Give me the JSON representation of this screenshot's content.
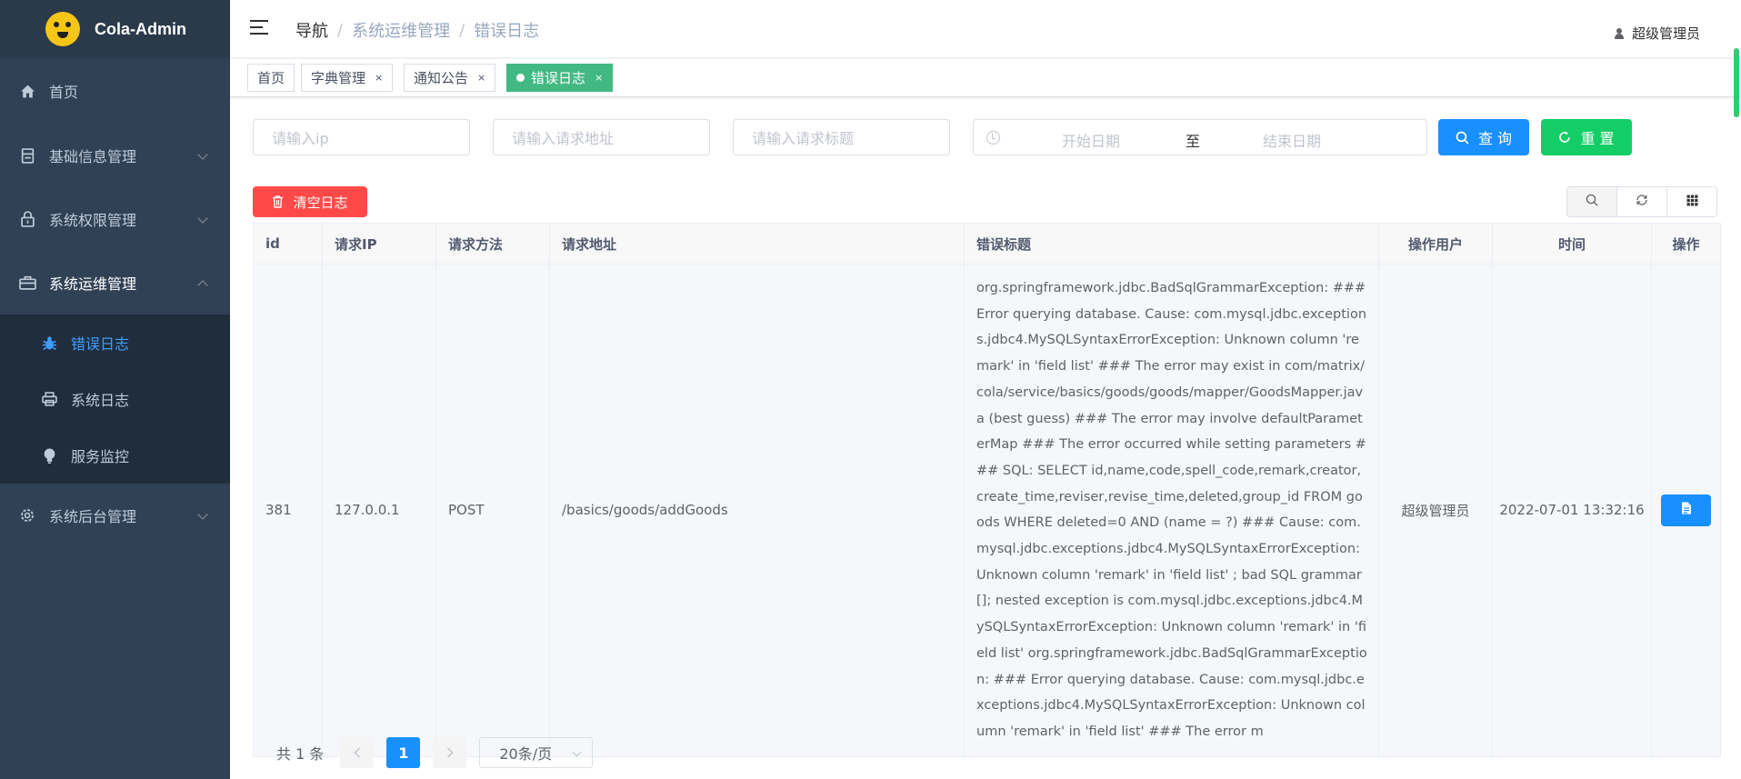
{
  "app": {
    "title": "Cola-Admin"
  },
  "sidebar": {
    "items": [
      {
        "label": "首页",
        "icon": "home-icon"
      },
      {
        "label": "基础信息管理",
        "icon": "document-icon"
      },
      {
        "label": "系统权限管理",
        "icon": "lock-icon"
      },
      {
        "label": "系统运维管理",
        "icon": "toolbox-icon"
      },
      {
        "label": "系统后台管理",
        "icon": "gear-icon"
      }
    ],
    "subitems": [
      {
        "label": "错误日志",
        "icon": "bug-icon"
      },
      {
        "label": "系统日志",
        "icon": "printer-icon"
      },
      {
        "label": "服务监控",
        "icon": "bulb-icon"
      }
    ]
  },
  "header": {
    "breadcrumb": [
      "导航",
      "系统运维管理",
      "错误日志"
    ],
    "user": "超级管理员"
  },
  "tags": [
    {
      "label": "首页"
    },
    {
      "label": "字典管理",
      "close": "×"
    },
    {
      "label": "通知公告",
      "close": "×"
    },
    {
      "label": "错误日志",
      "close": "×"
    }
  ],
  "filters": {
    "ip_placeholder": "请输入ip",
    "url_placeholder": "请输入请求地址",
    "title_placeholder": "请输入请求标题",
    "start_placeholder": "开始日期",
    "range_separator": "至",
    "end_placeholder": "结束日期",
    "search_label": "查 询",
    "reset_label": "重 置"
  },
  "actions": {
    "clear_label": "清空日志"
  },
  "table": {
    "columns": [
      "id",
      "请求IP",
      "请求方法",
      "请求地址",
      "错误标题",
      "操作用户",
      "时间",
      "操作"
    ],
    "rows": [
      {
        "id": "381",
        "ip": "127.0.0.1",
        "method": "POST",
        "url": "/basics/goods/addGoods",
        "message": "org.springframework.jdbc.BadSqlGrammarException: ### Error querying database. Cause: com.mysql.jdbc.exceptions.jdbc4.MySQLSyntaxErrorException: Unknown column 'remark' in 'field list' ### The error may exist in com/matrix/cola/service/basics/goods/goods/mapper/GoodsMapper.java (best guess) ### The error may involve defaultParameterMap ### The error occurred while setting parameters ### SQL: SELECT id,name,code,spell_code,remark,creator,create_time,reviser,revise_time,deleted,group_id FROM goods WHERE deleted=0 AND (name = ?) ### Cause: com.mysql.jdbc.exceptions.jdbc4.MySQLSyntaxErrorException: Unknown column 'remark' in 'field list' ; bad SQL grammar []; nested exception is com.mysql.jdbc.exceptions.jdbc4.MySQLSyntaxErrorException: Unknown column 'remark' in 'field list' org.springframework.jdbc.BadSqlGrammarException: ### Error querying database. Cause: com.mysql.jdbc.exceptions.jdbc4.MySQLSyntaxErrorException: Unknown column 'remark' in 'field list' ### The error m",
        "user": "超级管理员",
        "time": "2022-07-01 13:32:16"
      }
    ]
  },
  "pagination": {
    "total": "共 1 条",
    "current": "1",
    "page_size": "20条/页"
  },
  "colors": {
    "sidebar": "#304156",
    "primary": "#1890ff",
    "success": "#13ce66",
    "danger": "#ff4949",
    "tag_active": "#42b983"
  }
}
